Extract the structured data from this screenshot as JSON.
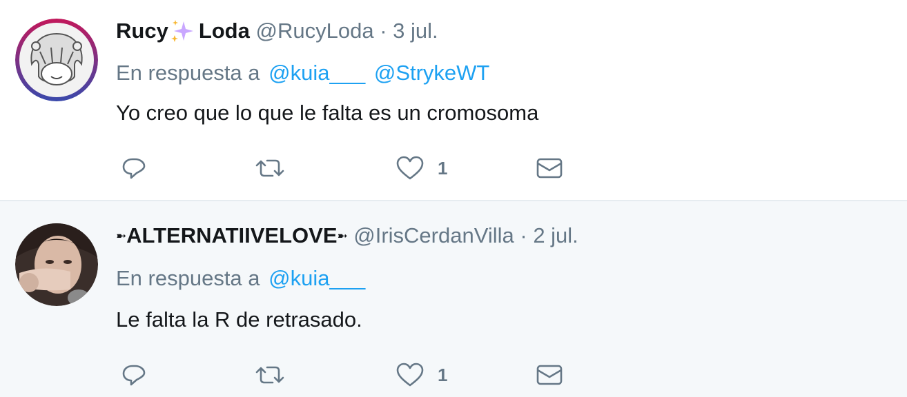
{
  "tweets": [
    {
      "display_name_part1": "Rucy",
      "display_name_part2": "Loda",
      "handle": "@RucyLoda",
      "separator": "·",
      "date": "3 jul.",
      "reply_prefix": "En respuesta a",
      "mentions": [
        "@kuia___",
        "@StrykeWT"
      ],
      "text": "Yo creo que lo que le falta es un cromosoma",
      "like_count": "1",
      "icons": [
        "reply-icon",
        "retweet-icon",
        "heart-icon",
        "envelope-icon"
      ]
    },
    {
      "name_prefix_glyph": "➼",
      "display_name": "ALTERNATIIVELOVE",
      "name_suffix_glyph": "➼",
      "handle": "@IrisCerdanVilla",
      "separator": "·",
      "date": "2 jul.",
      "reply_prefix": "En respuesta a",
      "mentions": [
        "@kuia___"
      ],
      "text": "Le falta la R de retrasado.",
      "like_count": "1",
      "icons": [
        "reply-icon",
        "retweet-icon",
        "heart-icon",
        "envelope-icon"
      ]
    }
  ],
  "colors": {
    "link": "#1da1f2",
    "secondary_text": "#657786",
    "primary_text": "#14171a",
    "reply_background": "#f5f8fa",
    "sparkle": "#b388ff"
  }
}
